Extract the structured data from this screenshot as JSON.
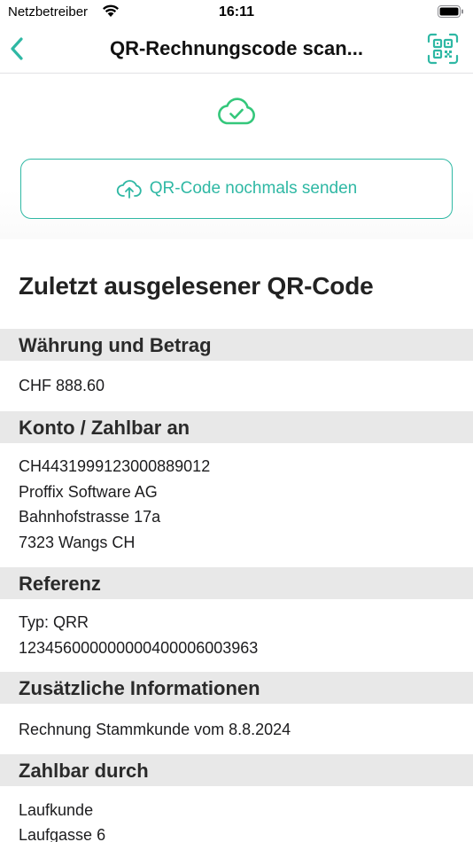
{
  "status_bar": {
    "carrier": "Netzbetreiber",
    "time": "16:11"
  },
  "nav": {
    "title": "QR-Rechnungscode scan..."
  },
  "actions": {
    "resend_label": "QR-Code nochmals senden"
  },
  "colors": {
    "accent": "#2fb8a4",
    "success": "#34c77b"
  },
  "content": {
    "heading": "Zuletzt ausgelesener QR-Code",
    "sections": [
      {
        "title": "Währung und Betrag",
        "lines": [
          "CHF 888.60"
        ]
      },
      {
        "title": "Konto / Zahlbar an",
        "lines": [
          "CH4431999123000889012",
          "Proffix Software AG",
          "Bahnhofstrasse 17a",
          "7323 Wangs CH"
        ]
      },
      {
        "title": "Referenz",
        "lines": [
          "Typ: QRR",
          "123456000000000400006003963"
        ]
      },
      {
        "title": "Zusätzliche Informationen",
        "lines": [
          "Rechnung Stammkunde vom 8.8.2024"
        ]
      },
      {
        "title": "Zahlbar durch",
        "lines": [
          "Laufkunde",
          "Laufgasse 6"
        ]
      }
    ]
  }
}
